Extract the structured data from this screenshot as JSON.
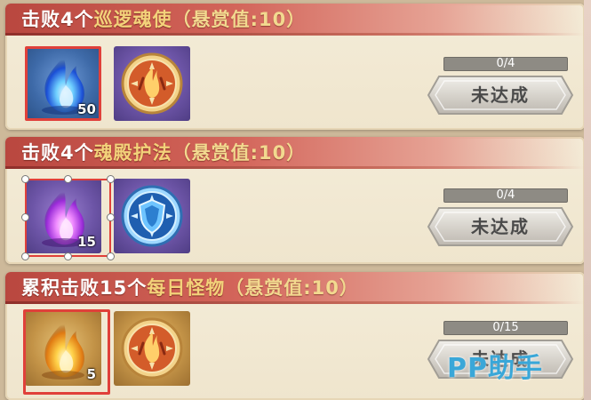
{
  "tasks": [
    {
      "title_main": "击败4个",
      "title_target": "巡逻魂使",
      "title_reward": "（悬赏值:10）",
      "item1": {
        "icon": "blue-soul-fire-icon",
        "count": "50"
      },
      "item2": {
        "icon": "fire-guardian-medal-icon"
      },
      "progress_text": "0/4",
      "progress": 0,
      "button_label": "未达成"
    },
    {
      "title_main": "击败4个",
      "title_target": "魂殿护法",
      "title_reward": "（悬赏值:10）",
      "item1": {
        "icon": "purple-soul-fire-icon",
        "count": "15"
      },
      "item2": {
        "icon": "blue-shield-medal-icon"
      },
      "progress_text": "0/4",
      "progress": 0,
      "button_label": "未达成"
    },
    {
      "title_main": "累积击败15个",
      "title_target": "每日怪物",
      "title_reward": "（悬赏值:10）",
      "item1": {
        "icon": "golden-soul-fire-icon",
        "count": "5"
      },
      "item2": {
        "icon": "fire-guardian-medal-icon"
      },
      "progress_text": "0/15",
      "progress": 0,
      "button_label": "未达成"
    }
  ],
  "watermark": "PP助手",
  "colors": {
    "header_red": "#c2493f",
    "highlight_gold": "#f3d27a",
    "selection_red": "#e0403a",
    "button_gray": "#d7d3cc"
  }
}
